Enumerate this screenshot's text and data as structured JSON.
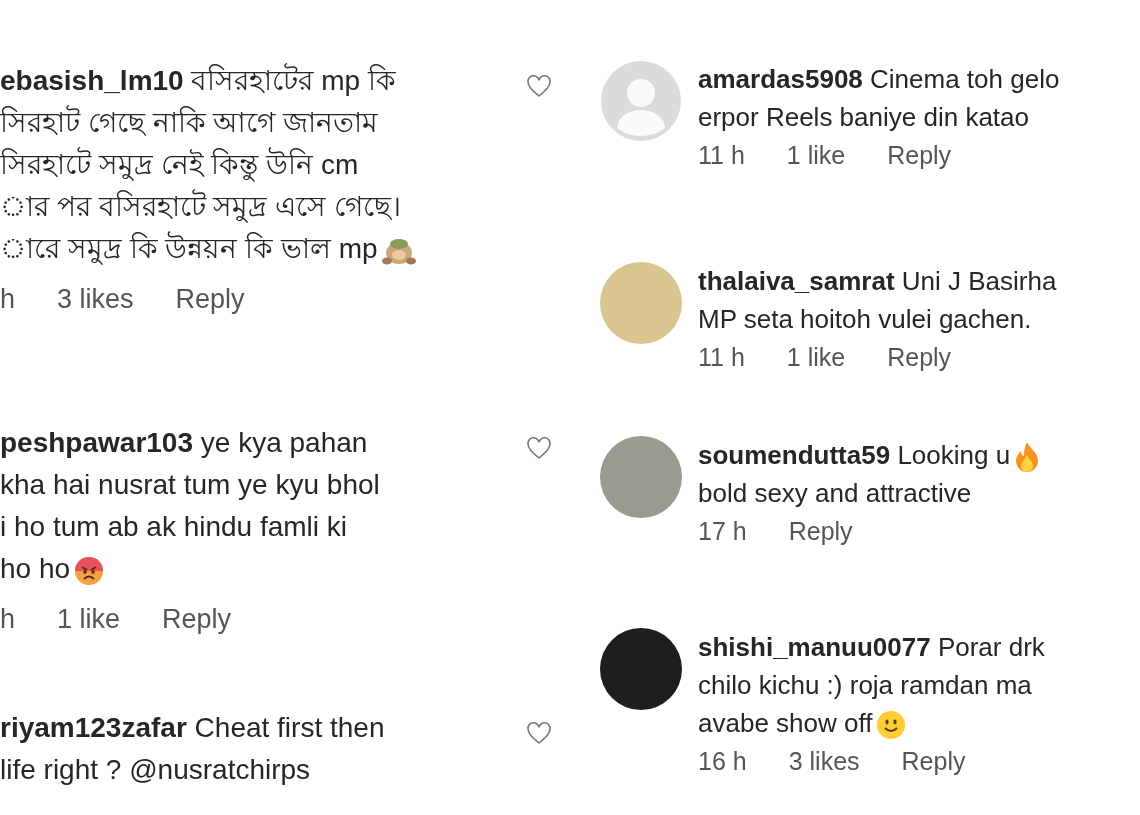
{
  "left_column": {
    "comments": [
      {
        "username": "ebasish_lm10",
        "lines": [
          {
            "text": "বসিরহাটের mp কি"
          },
          {
            "text": "সিরহাট গেছে নাকি আগে জানতাম"
          },
          {
            "text": "সিরহাটে সমুদ্র নেই কিন্তু উনি cm"
          },
          {
            "text": "ার পর বসিরহাটে সমুদ্র এসে গেছে।"
          },
          {
            "text": "ারে সমুদ্র কি উন্নয়ন কি ভাল mp",
            "emoji": {
              "kind": "monkey"
            }
          }
        ],
        "time": "h",
        "likes": "3 likes",
        "reply": "Reply",
        "liked": false
      },
      {
        "username": "peshpawar103",
        "lines": [
          {
            "text": "ye kya pahan"
          },
          {
            "text": "kha hai nusrat tum ye kyu bhol"
          },
          {
            "text": "i ho tum ab ak hindu famli ki"
          },
          {
            "text": "ho ho",
            "emoji": {
              "kind": "angry"
            }
          }
        ],
        "time": "h",
        "likes": "1 like",
        "reply": "Reply",
        "liked": false
      },
      {
        "username": "riyam123zafar",
        "lines": [
          {
            "text": "Cheat first then"
          },
          {
            "text": "life right ? @nusratchirps"
          }
        ],
        "liked": false
      }
    ]
  },
  "right_column": {
    "comments": [
      {
        "kind": "default_avatar",
        "username": "amardas5908",
        "lines": [
          {
            "text": "Cinema toh gelo"
          },
          {
            "text": "erpor Reels baniye din katao"
          }
        ],
        "time": "11 h",
        "likes": "1 like",
        "reply": "Reply"
      },
      {
        "kind": "photo_avatar",
        "username": "thalaiva_samrat",
        "lines": [
          {
            "text": "Uni J Basirha"
          },
          {
            "text": "MP seta hoitoh vulei gachen."
          }
        ],
        "time": "11 h",
        "likes": "1 like",
        "reply": "Reply"
      },
      {
        "kind": "photo_avatar",
        "username": "soumendutta59",
        "lines": [
          {
            "text": "Looking u",
            "emoji": {
              "kind": "fire"
            }
          },
          {
            "text": "bold sexy and attractive"
          }
        ],
        "time": "17 h",
        "reply": "Reply"
      },
      {
        "kind": "photo_avatar",
        "username": "shishi_manuu0077",
        "lines": [
          {
            "text": "Porar drk"
          },
          {
            "text": "chilo kichu :) roja ramdan ma"
          },
          {
            "text": "avabe show off",
            "emoji": {
              "kind": "smile"
            }
          }
        ],
        "time": "16 h",
        "likes": "3 likes",
        "reply": "Reply"
      }
    ]
  }
}
